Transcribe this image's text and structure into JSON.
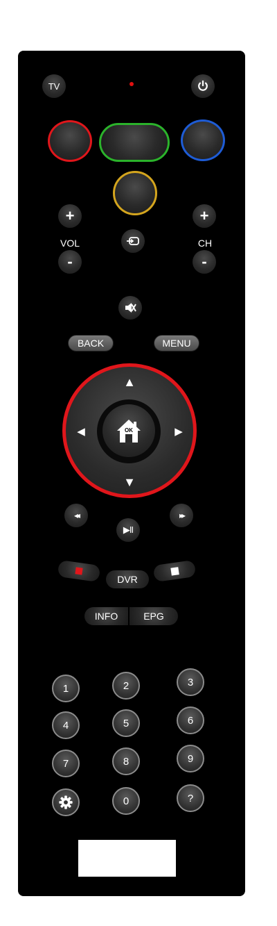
{
  "remote": {
    "tv_label": "TV",
    "power_glyph": "⏻",
    "vol_label": "VOL",
    "ch_label": "CH",
    "plus": "+",
    "minus": "-",
    "back_label": "BACK",
    "menu_label": "MENU",
    "ok_label": "OK",
    "up": "▲",
    "down": "▼",
    "left": "◀",
    "right": "▶",
    "rewind": "◂◂",
    "fast_forward": "▸▸",
    "play_pause": "▶II",
    "dvr_label": "DVR",
    "info_label": "INFO",
    "epg_label": "EPG",
    "numbers": [
      "1",
      "2",
      "3",
      "4",
      "5",
      "6",
      "7",
      "8",
      "9",
      "0"
    ],
    "help_label": "?",
    "colors": {
      "red": "#e0161b",
      "green": "#2bb32b",
      "blue": "#1e5cd6",
      "yellow": "#d4a51e",
      "led": "#e01010"
    }
  }
}
